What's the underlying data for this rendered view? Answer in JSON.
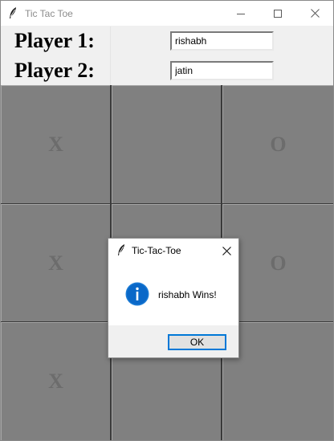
{
  "window": {
    "title": "Tic Tac Toe",
    "icon": "feather-icon",
    "controls": [
      "minimize-icon",
      "maximize-icon",
      "close-icon"
    ]
  },
  "players": [
    {
      "label": "Player 1:",
      "value": "rishabh"
    },
    {
      "label": "Player 2:",
      "value": "jatin"
    }
  ],
  "board": {
    "cells": [
      "X",
      "",
      "O",
      "X",
      "",
      "O",
      "X",
      "",
      ""
    ]
  },
  "dialog": {
    "title": "Tic-Tac-Toe",
    "icon": "info-icon",
    "message": "rishabh Wins!",
    "ok_label": "OK"
  },
  "colors": {
    "cell_bg": "#808080",
    "mark": "#6c6c6c",
    "accent": "#0078d7"
  }
}
